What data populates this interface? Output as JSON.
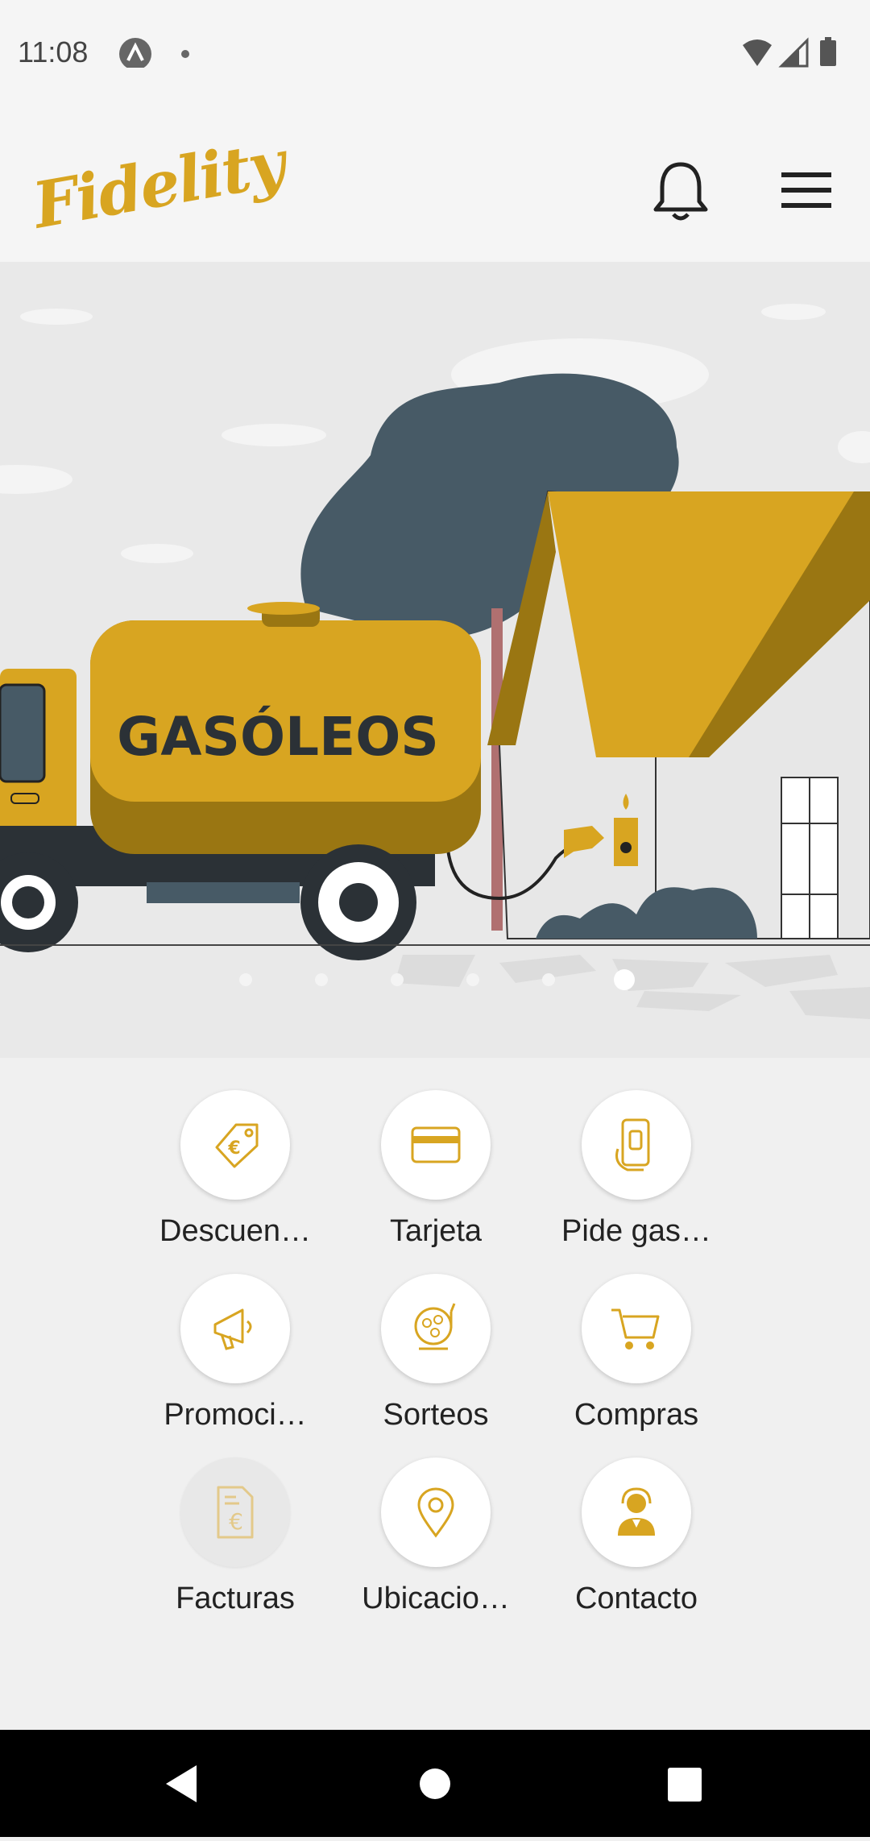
{
  "status_bar": {
    "time": "11:08"
  },
  "header": {
    "logo_text": "Fidelity",
    "bell_icon": "bell-icon",
    "menu_icon": "hamburger-menu-icon"
  },
  "hero": {
    "truck_text": "GASÓLEOS",
    "carousel_total": 6,
    "carousel_active": 6
  },
  "menu": {
    "items": [
      {
        "label": "Descuen…",
        "icon": "discount-tag-icon"
      },
      {
        "label": "Tarjeta",
        "icon": "card-icon"
      },
      {
        "label": "Pide gas…",
        "icon": "phone-gas-order-icon"
      },
      {
        "label": "Promoci…",
        "icon": "megaphone-icon"
      },
      {
        "label": "Sorteos",
        "icon": "raffle-drum-icon"
      },
      {
        "label": "Compras",
        "icon": "cart-icon"
      },
      {
        "label": "Facturas",
        "icon": "invoice-euro-icon"
      },
      {
        "label": "Ubicacio…",
        "icon": "location-pin-icon"
      },
      {
        "label": "Contacto",
        "icon": "support-agent-icon"
      }
    ]
  },
  "colors": {
    "accent": "#d8a521",
    "accent_dark": "#9a7612",
    "tree": "#475a66",
    "text": "#222222"
  }
}
